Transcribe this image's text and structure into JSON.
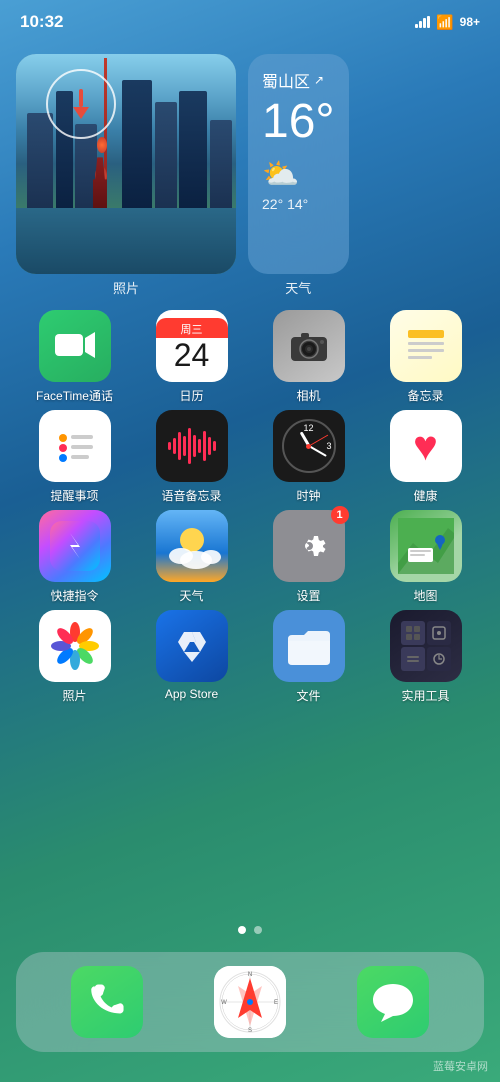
{
  "statusBar": {
    "time": "10:32",
    "battery": "98+",
    "batteryPercent": "98+"
  },
  "widgets": {
    "photos": {
      "label": "照片"
    },
    "weather": {
      "location": "蜀山区",
      "temperature": "16°",
      "condition": "Cloudy",
      "high": "22°",
      "low": "14°",
      "label": "天气"
    }
  },
  "appRows": [
    [
      {
        "id": "facetime",
        "label": "FaceTime通话",
        "icon": "facetime"
      },
      {
        "id": "calendar",
        "label": "日历",
        "icon": "calendar",
        "calDay": "周三",
        "calDate": "24"
      },
      {
        "id": "camera",
        "label": "相机",
        "icon": "camera"
      },
      {
        "id": "notes",
        "label": "备忘录",
        "icon": "notes"
      }
    ],
    [
      {
        "id": "reminders",
        "label": "提醒事项",
        "icon": "reminders"
      },
      {
        "id": "voicememo",
        "label": "语音备忘录",
        "icon": "voicememo"
      },
      {
        "id": "clock",
        "label": "时钟",
        "icon": "clock"
      },
      {
        "id": "health",
        "label": "健康",
        "icon": "health"
      }
    ],
    [
      {
        "id": "shortcuts",
        "label": "快捷指令",
        "icon": "shortcuts"
      },
      {
        "id": "weather",
        "label": "天气",
        "icon": "weather"
      },
      {
        "id": "settings",
        "label": "设置",
        "icon": "settings",
        "badge": "1"
      },
      {
        "id": "maps",
        "label": "地图",
        "icon": "maps"
      }
    ],
    [
      {
        "id": "photos",
        "label": "照片",
        "icon": "photos"
      },
      {
        "id": "appstore",
        "label": "App Store",
        "icon": "appstore"
      },
      {
        "id": "files",
        "label": "文件",
        "icon": "files"
      },
      {
        "id": "utilities",
        "label": "实用工具",
        "icon": "utilities"
      }
    ]
  ],
  "dock": [
    {
      "id": "phone",
      "label": "",
      "icon": "phone"
    },
    {
      "id": "safari",
      "label": "",
      "icon": "safari"
    },
    {
      "id": "messages",
      "label": "",
      "icon": "messages"
    }
  ],
  "pageDots": {
    "active": 0,
    "total": 2
  },
  "watermark": "蓝莓安卓网"
}
